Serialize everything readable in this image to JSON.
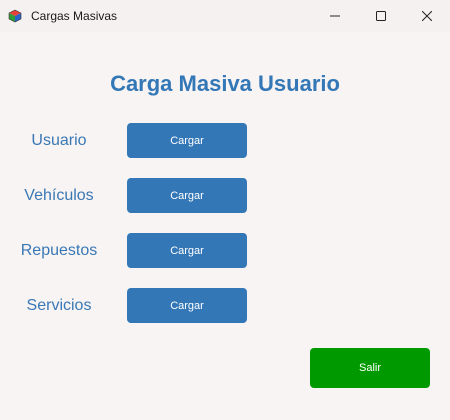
{
  "window": {
    "title": "Cargas Masivas",
    "icon": "cube-icon"
  },
  "main": {
    "heading": "Carga Masiva Usuario",
    "rows": [
      {
        "label": "Usuario",
        "button_label": "Cargar"
      },
      {
        "label": "Vehículos",
        "button_label": "Cargar"
      },
      {
        "label": "Repuestos",
        "button_label": "Cargar"
      },
      {
        "label": "Servicios",
        "button_label": "Cargar"
      }
    ],
    "exit_label": "Salir"
  },
  "colors": {
    "accent": "#3477b7",
    "exit": "#009900",
    "background": "#f7f4f3"
  }
}
